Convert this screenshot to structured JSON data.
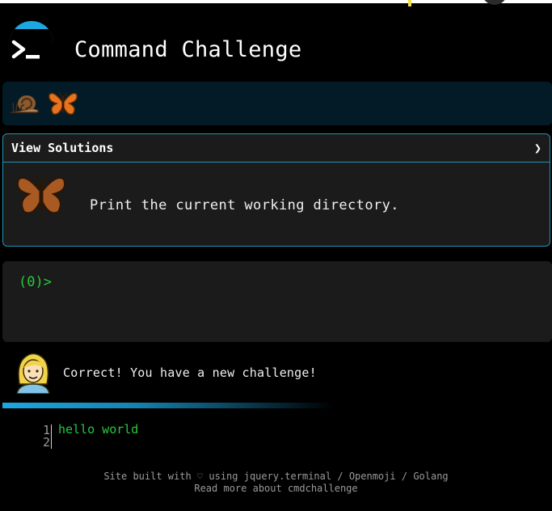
{
  "header": {
    "title": "Command Challenge"
  },
  "badges": [
    {
      "icon": "snail-icon"
    },
    {
      "icon": "butterfly-icon"
    }
  ],
  "solutions_panel": {
    "title": "View Solutions",
    "chevron": "❯",
    "challenge_icon": "butterfly-icon",
    "challenge_text": "Print the current working directory."
  },
  "terminal": {
    "prompt": "(0)>"
  },
  "assistant": {
    "avatar": "woman-avatar-icon",
    "message": "Correct! You have a new challenge!"
  },
  "editor": {
    "line_numbers": [
      "1",
      "2"
    ],
    "code": "hello world"
  },
  "footer": {
    "line1_prefix": "Site built with ♡ using",
    "link_jquery": "jquery.terminal",
    "sep1": "/",
    "link_openmoji": "Openmoji",
    "sep2": "/",
    "link_golang": "Golang",
    "line2": "Read more about cmdchallenge"
  },
  "colors": {
    "accent": "#1da7e0",
    "prompt_green": "#27c93f",
    "panel_bg": "#1b1b1b",
    "badge_strip_bg": "#021b26"
  }
}
